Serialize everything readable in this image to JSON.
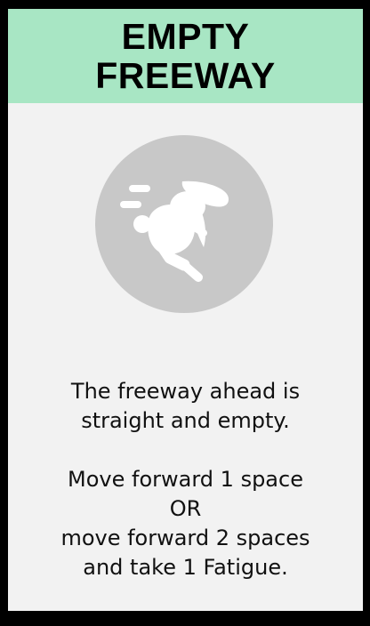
{
  "card": {
    "title_lines": [
      "EMPTY",
      "FREEWAY"
    ],
    "description_lines": [
      "The freeway ahead is",
      "straight and empty."
    ],
    "effect_lines": [
      "Move forward 1 space",
      "OR",
      "move forward 2 spaces",
      "and take 1 Fatigue."
    ],
    "icon": "running-rabbit-icon",
    "colors": {
      "header": "#a8e6c4",
      "card_background": "#f2f2f2",
      "icon_circle": "#c8c8c8",
      "border": "#000000"
    }
  }
}
